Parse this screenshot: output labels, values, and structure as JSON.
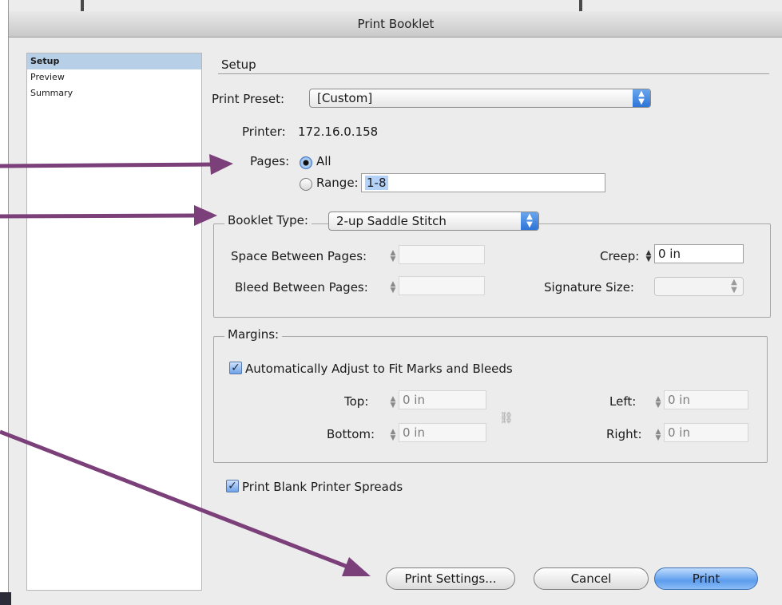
{
  "window": {
    "title": "Print Booklet"
  },
  "sidebar": {
    "items": [
      {
        "label": "Setup",
        "selected": true
      },
      {
        "label": "Preview",
        "selected": false
      },
      {
        "label": "Summary",
        "selected": false
      }
    ]
  },
  "setup": {
    "section_title": "Setup",
    "print_preset": {
      "label": "Print Preset:",
      "value": "[Custom]"
    },
    "printer": {
      "label": "Printer:",
      "value": "172.16.0.158"
    },
    "pages": {
      "label": "Pages:",
      "all_label": "All",
      "range_label": "Range:",
      "range_value": "1-8",
      "selected": "All"
    },
    "booklet": {
      "type_label": "Booklet Type:",
      "type_value": "2-up Saddle Stitch",
      "space_label": "Space Between Pages:",
      "bleed_label": "Bleed Between Pages:",
      "creep_label": "Creep:",
      "creep_value": "0 in",
      "signature_label": "Signature Size:"
    },
    "margins": {
      "legend": "Margins:",
      "auto_label": "Automatically Adjust to Fit Marks and Bleeds",
      "auto_checked": true,
      "top_label": "Top:",
      "top_value": "0 in",
      "bottom_label": "Bottom:",
      "bottom_value": "0 in",
      "left_label": "Left:",
      "left_value": "0 in",
      "right_label": "Right:",
      "right_value": "0 in"
    },
    "blank_spreads": {
      "label": "Print Blank Printer Spreads",
      "checked": true
    }
  },
  "buttons": {
    "print_settings": "Print Settings...",
    "cancel": "Cancel",
    "print": "Print"
  },
  "colors": {
    "annotation_arrow": "#7b3f7a",
    "accent_blue": "#5c9cec"
  }
}
